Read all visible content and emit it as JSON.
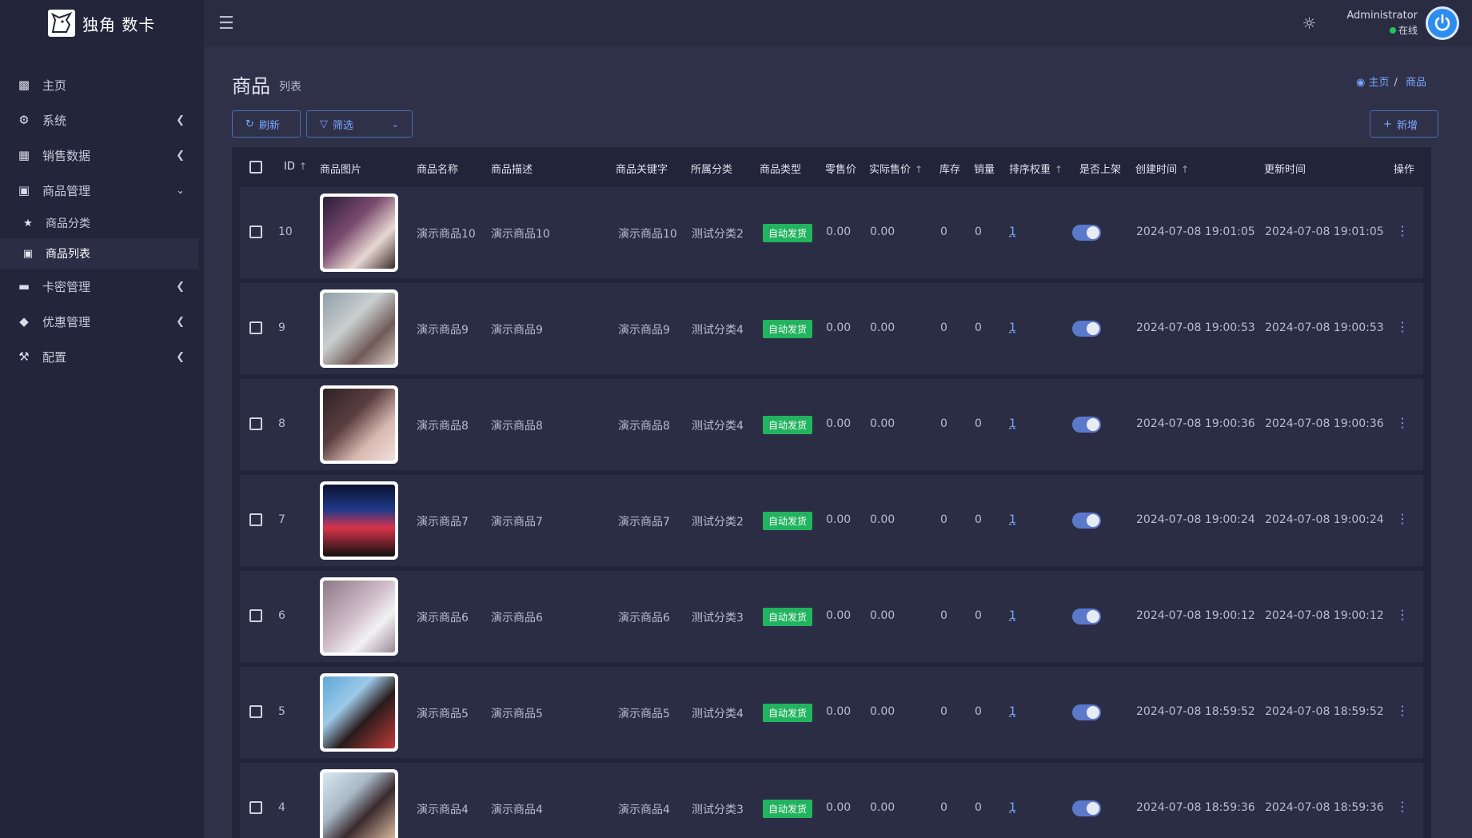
{
  "brand": {
    "title": "独角 数卡"
  },
  "header": {
    "user_name": "Administrator",
    "user_status": "在线"
  },
  "sidebar": {
    "items": [
      {
        "label": "主页",
        "icon": "bar-chart-icon"
      },
      {
        "label": "系统",
        "icon": "gear-icon"
      },
      {
        "label": "销售数据",
        "icon": "table-icon"
      },
      {
        "label": "商品管理",
        "icon": "shopping-bag-icon"
      },
      {
        "label": "卡密管理",
        "icon": "credit-card-icon"
      },
      {
        "label": "优惠管理",
        "icon": "diamond-icon"
      },
      {
        "label": "配置",
        "icon": "wrench-icon"
      }
    ],
    "subitems": [
      {
        "label": "商品分类",
        "icon": "star-icon"
      },
      {
        "label": "商品列表",
        "icon": "shopping-bag-icon"
      }
    ]
  },
  "page": {
    "title": "商品",
    "subtitle": "列表"
  },
  "breadcrumb": {
    "home": "主页",
    "current": "商品"
  },
  "toolbar": {
    "refresh": "刷新",
    "filter": "筛选",
    "add": "新增"
  },
  "table": {
    "columns": [
      "ID",
      "商品图片",
      "商品名称",
      "商品描述",
      "商品关键字",
      "所属分类",
      "商品类型",
      "零售价",
      "实际售价",
      "库存",
      "销量",
      "排序权重",
      "是否上架",
      "创建时间",
      "更新时间",
      "操作"
    ],
    "rows": [
      {
        "id": "10",
        "name": "演示商品10",
        "desc": "演示商品10",
        "keyword": "演示商品10",
        "category": "测试分类2",
        "type": "自动发货",
        "retail": "0.00",
        "actual": "0.00",
        "stock": "0",
        "sales": "0",
        "weight": "1",
        "created": "2024-07-08 19:01:05",
        "updated": "2024-07-08 19:01:05"
      },
      {
        "id": "9",
        "name": "演示商品9",
        "desc": "演示商品9",
        "keyword": "演示商品9",
        "category": "测试分类4",
        "type": "自动发货",
        "retail": "0.00",
        "actual": "0.00",
        "stock": "0",
        "sales": "0",
        "weight": "1",
        "created": "2024-07-08 19:00:53",
        "updated": "2024-07-08 19:00:53"
      },
      {
        "id": "8",
        "name": "演示商品8",
        "desc": "演示商品8",
        "keyword": "演示商品8",
        "category": "测试分类4",
        "type": "自动发货",
        "retail": "0.00",
        "actual": "0.00",
        "stock": "0",
        "sales": "0",
        "weight": "1",
        "created": "2024-07-08 19:00:36",
        "updated": "2024-07-08 19:00:36"
      },
      {
        "id": "7",
        "name": "演示商品7",
        "desc": "演示商品7",
        "keyword": "演示商品7",
        "category": "测试分类2",
        "type": "自动发货",
        "retail": "0.00",
        "actual": "0.00",
        "stock": "0",
        "sales": "0",
        "weight": "1",
        "created": "2024-07-08 19:00:24",
        "updated": "2024-07-08 19:00:24"
      },
      {
        "id": "6",
        "name": "演示商品6",
        "desc": "演示商品6",
        "keyword": "演示商品6",
        "category": "测试分类3",
        "type": "自动发货",
        "retail": "0.00",
        "actual": "0.00",
        "stock": "0",
        "sales": "0",
        "weight": "1",
        "created": "2024-07-08 19:00:12",
        "updated": "2024-07-08 19:00:12"
      },
      {
        "id": "5",
        "name": "演示商品5",
        "desc": "演示商品5",
        "keyword": "演示商品5",
        "category": "测试分类4",
        "type": "自动发货",
        "retail": "0.00",
        "actual": "0.00",
        "stock": "0",
        "sales": "0",
        "weight": "1",
        "created": "2024-07-08 18:59:52",
        "updated": "2024-07-08 18:59:52"
      },
      {
        "id": "4",
        "name": "演示商品4",
        "desc": "演示商品4",
        "keyword": "演示商品4",
        "category": "测试分类3",
        "type": "自动发货",
        "retail": "0.00",
        "actual": "0.00",
        "stock": "0",
        "sales": "0",
        "weight": "1",
        "created": "2024-07-08 18:59:36",
        "updated": "2024-07-08 18:59:36"
      }
    ]
  },
  "colors": {
    "accent": "#7aa7ff",
    "badge": "#22b35e",
    "toggle_on": "#5b79c9"
  }
}
